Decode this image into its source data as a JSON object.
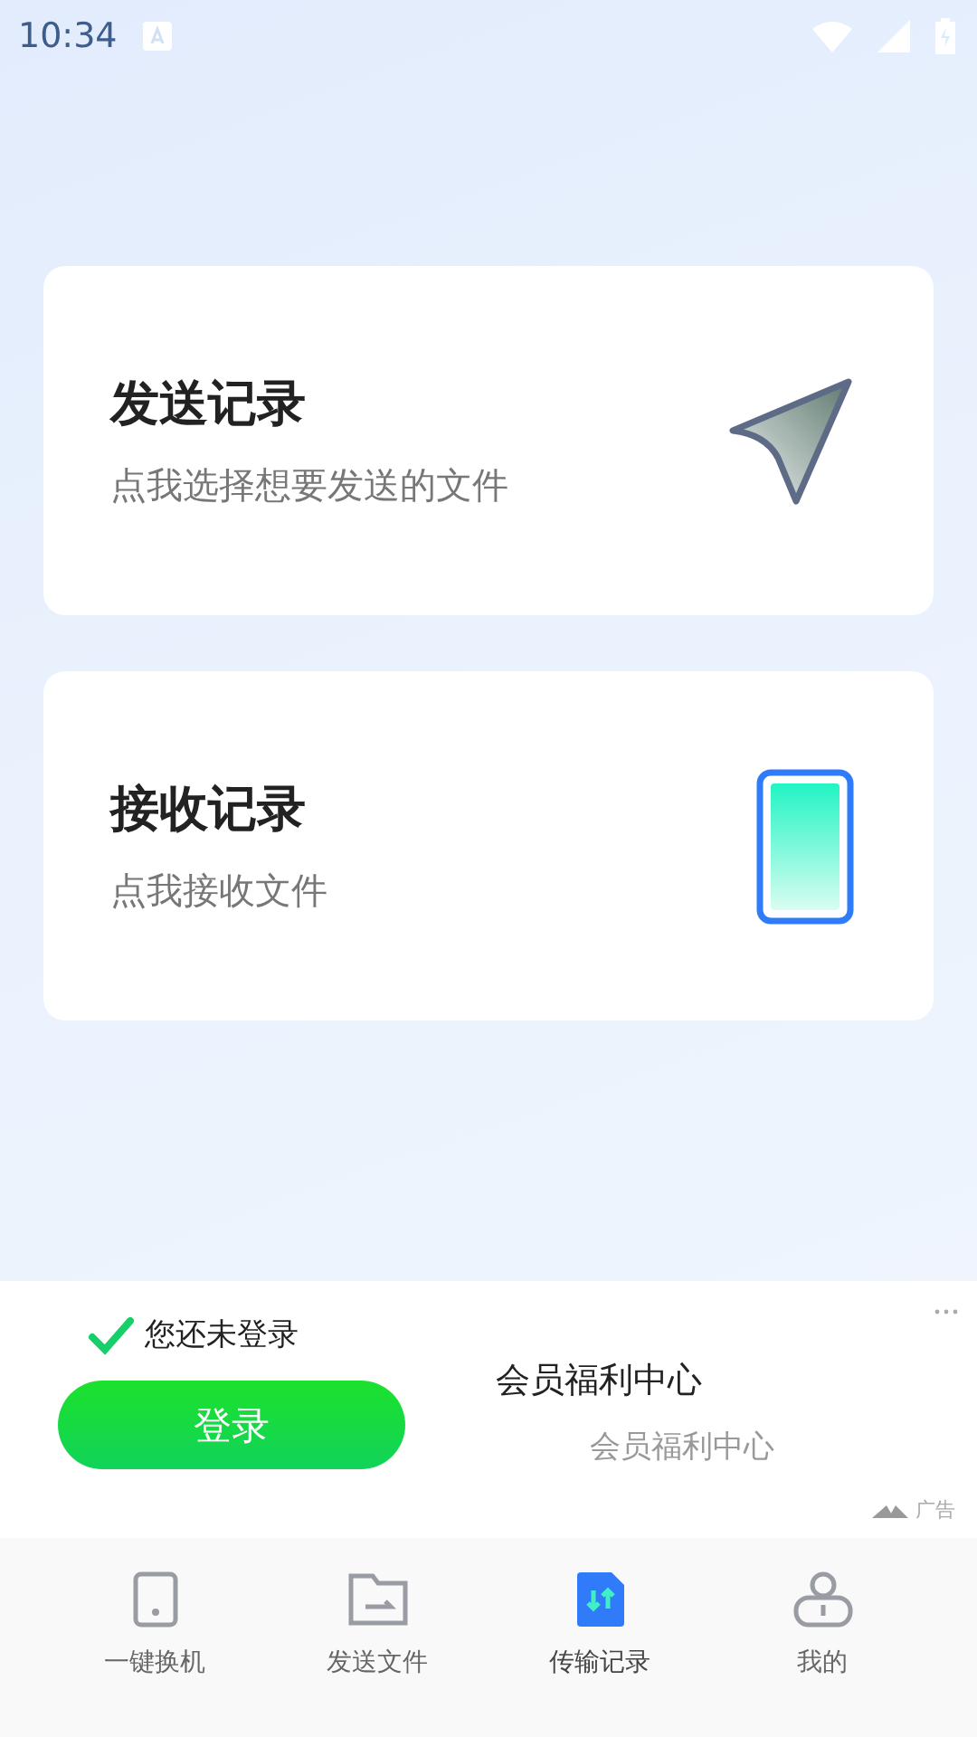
{
  "status_bar": {
    "time": "10:34"
  },
  "cards": [
    {
      "kind": "send",
      "title": "发送记录",
      "subtitle": "点我选择想要发送的文件"
    },
    {
      "kind": "receive",
      "title": "接收记录",
      "subtitle": "点我接收文件"
    }
  ],
  "ad": {
    "status": "您还未登录",
    "button": "登录",
    "title": "会员福利中心",
    "subtitle": "会员福利中心",
    "label": "广告"
  },
  "tabs": [
    {
      "kind": "phone",
      "label": "一键换机",
      "selected": false
    },
    {
      "kind": "folder",
      "label": "发送文件",
      "selected": false
    },
    {
      "kind": "transfer",
      "label": "传输记录",
      "selected": true
    },
    {
      "kind": "user",
      "label": "我的",
      "selected": false
    }
  ]
}
